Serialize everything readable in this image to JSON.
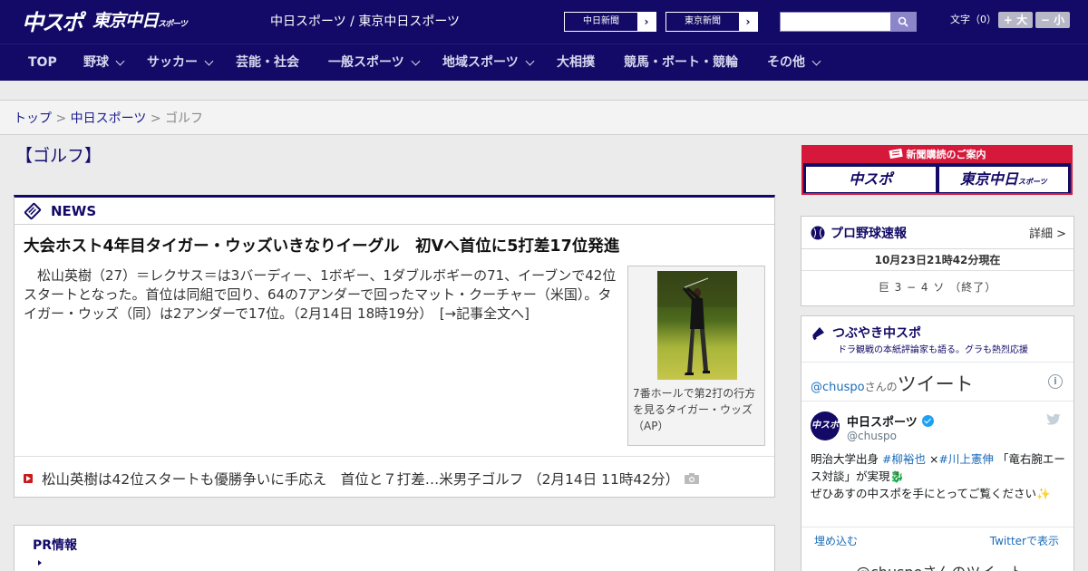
{
  "header": {
    "logo_main": "中スポ",
    "logo_sub": "東京中日",
    "logo_sub_small": "スポーツ",
    "site_name": "中日スポーツ / 東京中日スポーツ",
    "btn_chunichi": "中日新聞",
    "btn_tokyo": "東京新聞",
    "search_value": "",
    "search_placeholder": "",
    "font_size_label": "文字（0）",
    "font_bigger": "+ 大",
    "font_smaller": "− 小"
  },
  "nav": {
    "items": [
      {
        "label": "TOP",
        "dropdown": false
      },
      {
        "label": "野球",
        "dropdown": true
      },
      {
        "label": "サッカー",
        "dropdown": true
      },
      {
        "label": "芸能・社会",
        "dropdown": false
      },
      {
        "label": "一般スポーツ",
        "dropdown": true
      },
      {
        "label": "地域スポーツ",
        "dropdown": true
      },
      {
        "label": "大相撲",
        "dropdown": false
      },
      {
        "label": "競馬・ボート・競輪",
        "dropdown": false
      },
      {
        "label": "その他",
        "dropdown": true
      }
    ]
  },
  "breadcrumb": {
    "top": "トップ",
    "sep1": " > ",
    "section": "中日スポーツ",
    "sep2": " > ",
    "current": "ゴルフ"
  },
  "page_title": "【ゴルフ】",
  "news": {
    "label": "NEWS",
    "headline": "大会ホスト4年目タイガー・ウッズいきなりイーグル　初Vへ首位に5打差17位発進",
    "lead": "　松山英樹（27）＝レクサス＝は3バーディー、1ボギー、1ダブルボギーの71、イーブンで42位スタートとなった。首位は同組で回り、64の7アンダーで回ったマット・クーチャー（米国）。タイガー・ウッズ（同）は2アンダーで17位。（2月14日 18時19分）　[→記事全文へ]",
    "photo_caption": "7番ホールで第2打の行方を見るタイガー・ウッズ（AP）",
    "sub_link": "松山英樹は42位スタートも優勝争いに手応え　首位と７打差…米男子ゴルフ （2月14日 11時42分）"
  },
  "pr": {
    "title": "PR情報"
  },
  "subscribe": {
    "title": "新聞購読のご案内",
    "logo1": "中スポ",
    "logo2": "東京中日",
    "logo2_small": "スポーツ"
  },
  "baseball": {
    "title": "プロ野球速報",
    "detail": "詳細 >",
    "updated": "10月23日21時42分現在",
    "score": "巨 3 − 4 ソ （終了）"
  },
  "tweets": {
    "title": "つぶやき中スポ",
    "subtitle": "ドラ観戦の本紙評論家も語る。グラも熱烈応援",
    "handle": "@chuspo",
    "san": "さんの",
    "tw": "ツイート",
    "account_name": "中日スポーツ",
    "account_user": "@chuspo",
    "avatar": "中スポ",
    "text1": "明治大学出身 ",
    "tag1": "#柳裕也",
    "text2": " ×",
    "tag2": "#川上憲伸",
    "text3": " 「竜右腕エース対談」が実現🐉",
    "text4": "ぜひあすの中スポを手にとってご覧ください✨",
    "embed": "埋め込む",
    "view_on_twitter": "Twitterで表示",
    "more": "@chuspoさんのツイート"
  },
  "colors": {
    "brand_navy": "#120a66",
    "subscribe_red": "#d6183a",
    "link_blue": "#1b6bb8"
  }
}
